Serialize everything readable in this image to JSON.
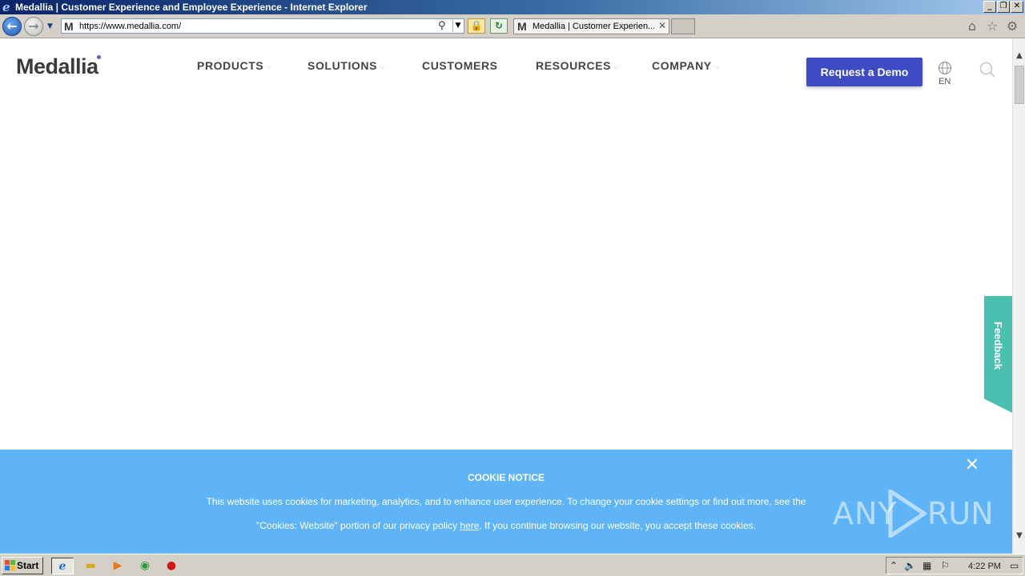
{
  "window": {
    "title": "Medallia | Customer Experience and Employee Experience - Internet Explorer",
    "minimize": "_",
    "restore": "❐",
    "close": "✕"
  },
  "browser": {
    "url": "https://www.medallia.com/",
    "favicon": "M",
    "tab_label": "Medallia | Customer Experien...",
    "tab_close": "✕"
  },
  "site": {
    "logo": "Medallia",
    "nav": [
      {
        "label": "PRODUCTS",
        "has_menu": true
      },
      {
        "label": "SOLUTIONS",
        "has_menu": true
      },
      {
        "label": "CUSTOMERS",
        "has_menu": false
      },
      {
        "label": "RESOURCES",
        "has_menu": true
      },
      {
        "label": "COMPANY",
        "has_menu": true
      }
    ],
    "chevron": "⌵",
    "cta": "Request a Demo",
    "language": "EN",
    "feedback": "Feedback",
    "accent": "#3d4bc4",
    "feedback_color": "#4bc0b0"
  },
  "cookie": {
    "heading": "COOKIE NOTICE",
    "line1": "This website uses cookies for marketing, analytics, and to enhance user experience. To change your cookie settings or find out more, see the",
    "line2_before": "\"Cookies: Website\" portion of our privacy policy ",
    "link": "here",
    "line2_after": ". If you continue browsing our website, you accept these cookies.",
    "close": "✕",
    "background": "#5fb4f7"
  },
  "watermark": {
    "left": "ANY",
    "right": "RUN"
  },
  "taskbar": {
    "start": "Start",
    "clock": "4:22 PM"
  }
}
